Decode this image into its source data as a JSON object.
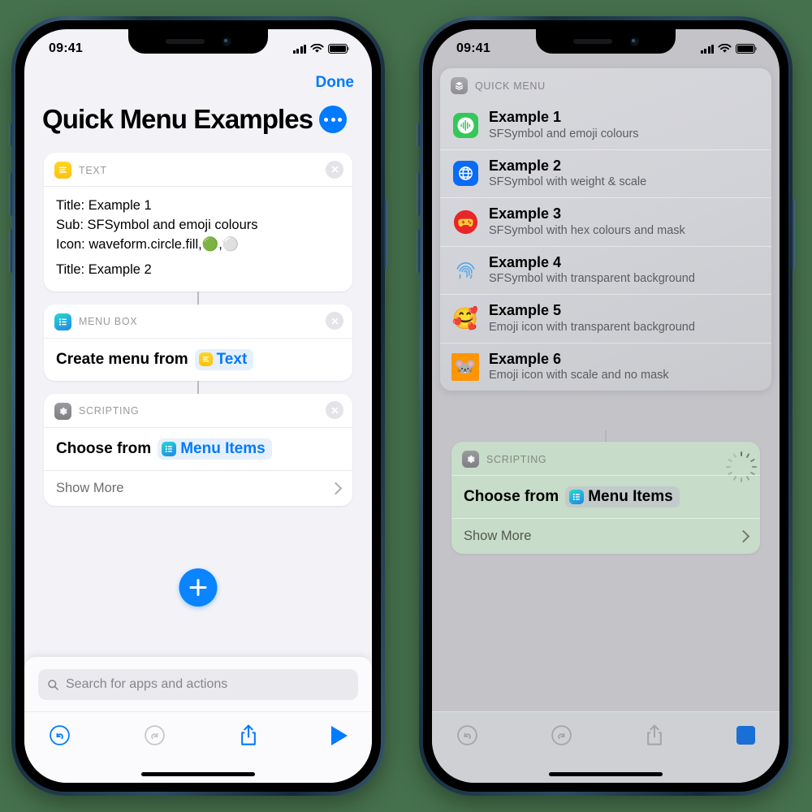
{
  "background_color": "#46714d",
  "accent_color": "#007aff",
  "phones": {
    "left": {
      "status": {
        "time": "09:41",
        "signal_icon": "cellular-bars-icon",
        "wifi_icon": "wifi-icon",
        "battery_icon": "battery-full-icon"
      },
      "nav": {
        "done_label": "Done"
      },
      "title": "Quick Menu Examples",
      "more_button": "more-ellipsis-button",
      "cards": [
        {
          "app_label": "TEXT",
          "icon": "text-app-icon",
          "lines": [
            "Title: Example 1",
            "Sub: SFSymbol and emoji colours",
            "Icon: waveform.circle.fill,🟢,⚪",
            "",
            "Title: Example 2"
          ]
        },
        {
          "app_label": "MENU BOX",
          "icon": "menu-box-app-icon",
          "action_prefix": "Create menu from",
          "token_label": "Text",
          "token_icon": "text-app-icon"
        },
        {
          "app_label": "SCRIPTING",
          "icon": "scripting-gear-icon",
          "action_prefix": "Choose from",
          "token_label": "Menu Items",
          "token_icon": "menu-box-app-icon",
          "show_more_label": "Show More"
        }
      ],
      "add_button": "add-action-button",
      "search": {
        "placeholder": "Search for apps and actions",
        "icon": "search-icon"
      },
      "toolbar": [
        {
          "name": "undo-button",
          "icon": "undo-icon",
          "enabled": true
        },
        {
          "name": "redo-button",
          "icon": "redo-icon",
          "enabled": false
        },
        {
          "name": "share-button",
          "icon": "share-icon",
          "enabled": true
        },
        {
          "name": "run-button",
          "icon": "play-icon",
          "enabled": true
        }
      ]
    },
    "right": {
      "status": {
        "time": "09:41",
        "signal_icon": "cellular-bars-icon",
        "wifi_icon": "wifi-icon",
        "battery_icon": "battery-full-icon"
      },
      "quick_menu": {
        "header_label": "QUICK MENU",
        "header_icon": "quick-menu-stack-icon",
        "items": [
          {
            "title": "Example 1",
            "subtitle": "SFSymbol and emoji colours",
            "icon": "waveform-circle-fill-icon",
            "icon_style": "green-rounded-square-white-waveform"
          },
          {
            "title": "Example 2",
            "subtitle": "SFSymbol with weight & scale",
            "icon": "globe-icon",
            "icon_style": "blue-rounded-square-white-globe"
          },
          {
            "title": "Example 3",
            "subtitle": "SFSymbol with hex colours and mask",
            "icon": "gamecontroller-fill-icon",
            "icon_style": "red-circle-yellow-controller"
          },
          {
            "title": "Example 4",
            "subtitle": "SFSymbol with transparent background",
            "icon": "touchid-fingerprint-icon",
            "icon_style": "transparent-blue-fingerprint"
          },
          {
            "title": "Example 5",
            "subtitle": "Emoji icon with transparent background",
            "icon": "smiling-face-with-hearts-emoji",
            "emoji": "🥰",
            "icon_style": "transparent"
          },
          {
            "title": "Example 6",
            "subtitle": "Emoji icon with scale and no mask",
            "icon": "mouse-face-emoji",
            "emoji": "🐭",
            "icon_style": "orange-square-no-mask"
          }
        ]
      },
      "scripting_card": {
        "app_label": "SCRIPTING",
        "icon": "scripting-gear-icon",
        "action_prefix": "Choose from",
        "token_label": "Menu Items",
        "token_icon": "menu-box-app-icon",
        "show_more_label": "Show More",
        "state_icon": "running-spinner-icon",
        "state": "running"
      },
      "toolbar": [
        {
          "name": "undo-button",
          "icon": "undo-icon",
          "enabled": false
        },
        {
          "name": "redo-button",
          "icon": "redo-icon",
          "enabled": false
        },
        {
          "name": "share-button",
          "icon": "share-icon",
          "enabled": false
        },
        {
          "name": "stop-button",
          "icon": "stop-square-icon",
          "enabled": true
        }
      ]
    }
  }
}
